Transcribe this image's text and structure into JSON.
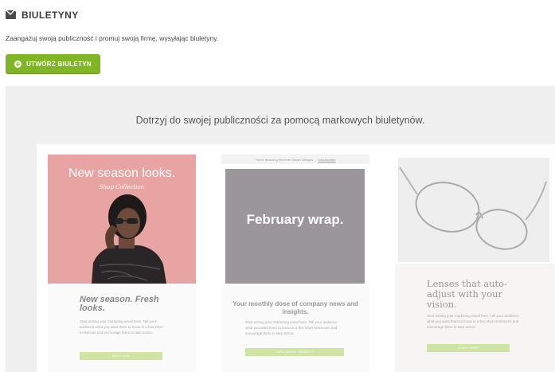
{
  "header": {
    "title": "BIULETYNY",
    "icon": "envelope-icon"
  },
  "subtitle": "Zaangażuj swoją publiczność i promuj swoją firmę, wysyłając biuletyny.",
  "create_button": {
    "label": "UTWÓRZ BIULETYN",
    "icon": "plus-circle-icon",
    "color": "#7fb527"
  },
  "promo": {
    "heading": "Dotrzyj do swojej publiczności za pomocą markowych biuletynów.",
    "cards": [
      {
        "hero_title": "New season looks.",
        "hero_subtitle": "Shop Collection",
        "headline": "New season. Fresh looks.",
        "body": "Start writing your marketing email here. Tell your audience what you want them to know in a few short sentences and encourage them to take action.",
        "button": "SHOP NOW"
      },
      {
        "top_bar_text": "You're receiving this from Seven Designs",
        "top_bar_link": "Unsubscribe",
        "hero_title": "February wrap.",
        "headline": "Your monthly dose of company news and insights.",
        "body": "Start writing your marketing email here. Tell your audience what you want them to know in a few short sentences and encourage them to take action.",
        "button": "VIEW LATEST PRODUCT"
      },
      {
        "headline": "Lenses that auto-adjust with your vision.",
        "body": "Start writing your marketing email here. Tell your audience what you want them to know in a few short sentences and encourage them to take action.",
        "button": "LEARN MORE"
      }
    ]
  }
}
